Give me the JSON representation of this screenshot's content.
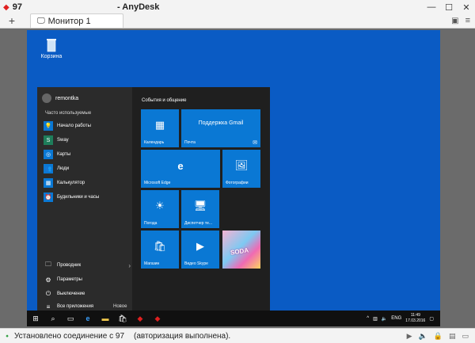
{
  "titlebar": {
    "id": "97",
    "title": "- AnyDesk"
  },
  "tabs": {
    "plus": "+",
    "monitor_label": "Монитор 1"
  },
  "desktop": {
    "recycle_label": "Корзина"
  },
  "startmenu": {
    "user": "remontka",
    "most_used_label": "Часто используемые",
    "apps": [
      {
        "label": "Начало работы",
        "color": "#0a78d4"
      },
      {
        "label": "Sway",
        "color": "#1e7d5a"
      },
      {
        "label": "Карты",
        "color": "#0a78d4"
      },
      {
        "label": "Люди",
        "color": "#0a78d4"
      },
      {
        "label": "Калькулятор",
        "color": "#0a78d4"
      },
      {
        "label": "Будильники и часы",
        "color": "#0a78d4"
      }
    ],
    "explorer": "Проводник",
    "settings": "Параметры",
    "power": "Выключение",
    "all_apps": "Все приложения",
    "new_label": "Новое",
    "group_title": "События и общение",
    "tiles": {
      "calendar": "Календарь",
      "mail_top": "Поддержка Gmail",
      "mail": "Почта",
      "edge": "Microsoft Edge",
      "photos": "Фотографии",
      "weather": "Погода",
      "taskmgr": "Диспетчер те...",
      "store": "Магазин",
      "skype": "Видео Skype",
      "candy": "SODA"
    }
  },
  "taskbar": {
    "lang": "ENG",
    "time": "11:49",
    "date": "17.03.2016"
  },
  "statusbar": {
    "connected": "Установлено соединение с 97",
    "auth": "(авторизация выполнена)."
  },
  "colors": {
    "desktop": "#0a5bc4",
    "tile": "#0a78d4",
    "startmenu": "#1f1f1f",
    "taskbar": "#101010"
  }
}
